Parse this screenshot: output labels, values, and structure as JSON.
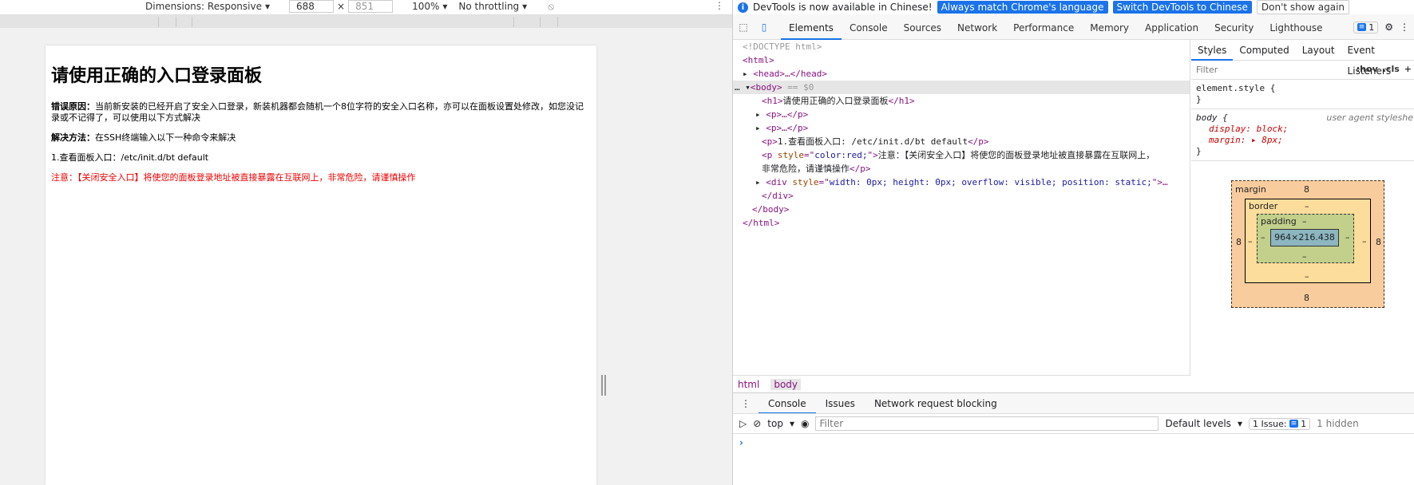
{
  "emulation": {
    "dimensions_label": "Dimensions: Responsive",
    "width_value": "688",
    "height_placeholder": "851",
    "zoom": "100%",
    "throttling": "No throttling"
  },
  "page": {
    "title": "请使用正确的入口登录面板",
    "reason_label": "错误原因：",
    "reason_text": "当前新安装的已经开启了安全入口登录，新装机器都会随机一个8位字符的安全入口名称，亦可以在面板设置处修改，如您没记录或不记得了，可以使用以下方式解决",
    "solution_label": "解决方法：",
    "solution_text": "在SSH终端输入以下一种命令来解决",
    "step1": "1.查看面板入口：/etc/init.d/bt default",
    "warning": "注意：【关闭安全入口】将使您的面板登录地址被直接暴露在互联网上，非常危险，请谨慎操作"
  },
  "devtools": {
    "infobar": {
      "message": "DevTools is now available in Chinese!",
      "btn_match": "Always match Chrome's language",
      "btn_switch": "Switch DevTools to Chinese",
      "btn_dont": "Don't show again"
    },
    "tabs": [
      "Elements",
      "Console",
      "Sources",
      "Network",
      "Performance",
      "Memory",
      "Application",
      "Security",
      "Lighthouse"
    ],
    "issues_count": "1",
    "dom": {
      "doctype": "<!DOCTYPE html>",
      "html_open": "<html>",
      "head": "<head>…</head>",
      "body_open": "<body>",
      "body_marker": "== $0",
      "h1_text": "请使用正确的入口登录面板",
      "p_collapsed": "<p>…</p>",
      "p_text": "1.查看面板入口: /etc/init.d/bt default",
      "p_style_attr": "color:red;",
      "p_red_text_1": "注意：【关闭安全入口】将使您的面板登录地址被直接暴露在互联网上，",
      "p_red_text_2": "非常危险，请谨慎操作",
      "div_style": "width: 0px; height: 0px; overflow: visible; position: static;",
      "div_close": "</div>",
      "body_close": "</body>",
      "html_close": "</html>"
    },
    "styles_tabs": [
      "Styles",
      "Computed",
      "Layout",
      "Event Listeners"
    ],
    "filter_placeholder": "Filter",
    "hov": ":hov",
    "cls": ".cls",
    "element_style": "element.style {",
    "body_rule": {
      "selector": "body {",
      "source": "user agent styleshe",
      "display": "display: block;",
      "margin": "margin: ▸ 8px;"
    },
    "box_model": {
      "margin_label": "margin",
      "margin_top": "8",
      "margin_bottom": "8",
      "margin_left": "8",
      "margin_right": "8",
      "border_label": "border",
      "padding_label": "padding",
      "dash": "–",
      "content": "964×216.438"
    },
    "breadcrumb": [
      "html",
      "body"
    ],
    "drawer_tabs": [
      "Console",
      "Issues",
      "Network request blocking"
    ],
    "console": {
      "context": "top",
      "filter_placeholder": "Filter",
      "levels": "Default levels",
      "issues": "1 Issue:",
      "issues_count": "1",
      "hidden": "1 hidden"
    }
  }
}
